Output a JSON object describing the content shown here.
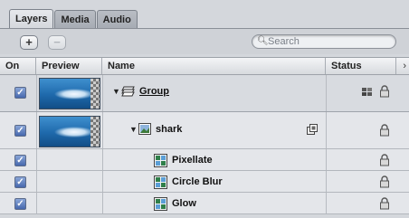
{
  "tabs": [
    {
      "label": "Layers",
      "active": true
    },
    {
      "label": "Media",
      "active": false
    },
    {
      "label": "Audio",
      "active": false
    }
  ],
  "toolbar": {
    "add_label": "+",
    "remove_label": "−",
    "search_placeholder": "Search"
  },
  "columns": {
    "on": "On",
    "preview": "Preview",
    "name": "Name",
    "status": "Status"
  },
  "rows": [
    {
      "name": "Group",
      "kind": "group",
      "on": true,
      "expanded": true,
      "has_preview": true
    },
    {
      "name": "shark",
      "kind": "image",
      "on": true,
      "expanded": true,
      "has_preview": true
    },
    {
      "name": "Pixellate",
      "kind": "filter",
      "on": true
    },
    {
      "name": "Circle Blur",
      "kind": "filter",
      "on": true
    },
    {
      "name": "Glow",
      "kind": "filter",
      "on": true
    }
  ],
  "colors": {
    "checkbox": "#4c6fb3",
    "panel": "#d4d7dc"
  }
}
